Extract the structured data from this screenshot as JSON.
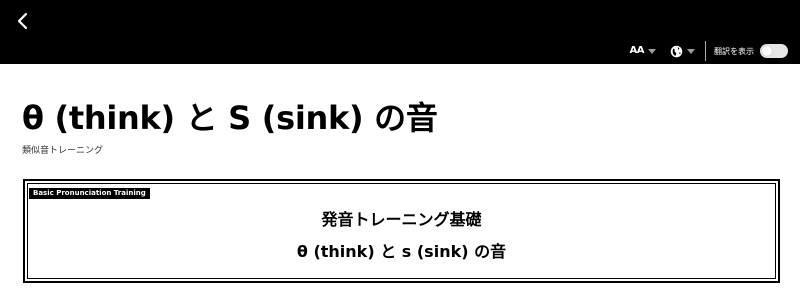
{
  "header": {
    "back_icon": "chevron-left-icon",
    "font_size_label": "AA",
    "language_icon": "globe-icon",
    "translate_toggle_label": "翻訳を表示",
    "translate_toggle_on": false
  },
  "main": {
    "title": "θ (think) と S (sink) の音",
    "subtitle": "類似音トレーニング",
    "card": {
      "tag": "Basic Pronunciation Training",
      "line1": "発音トレーニング基礎",
      "line2": "θ (think) と s (sink) の音"
    }
  },
  "colors": {
    "header_bg": "#000000",
    "page_bg": "#ffffff",
    "toggle_off": "#e6e6e6"
  }
}
